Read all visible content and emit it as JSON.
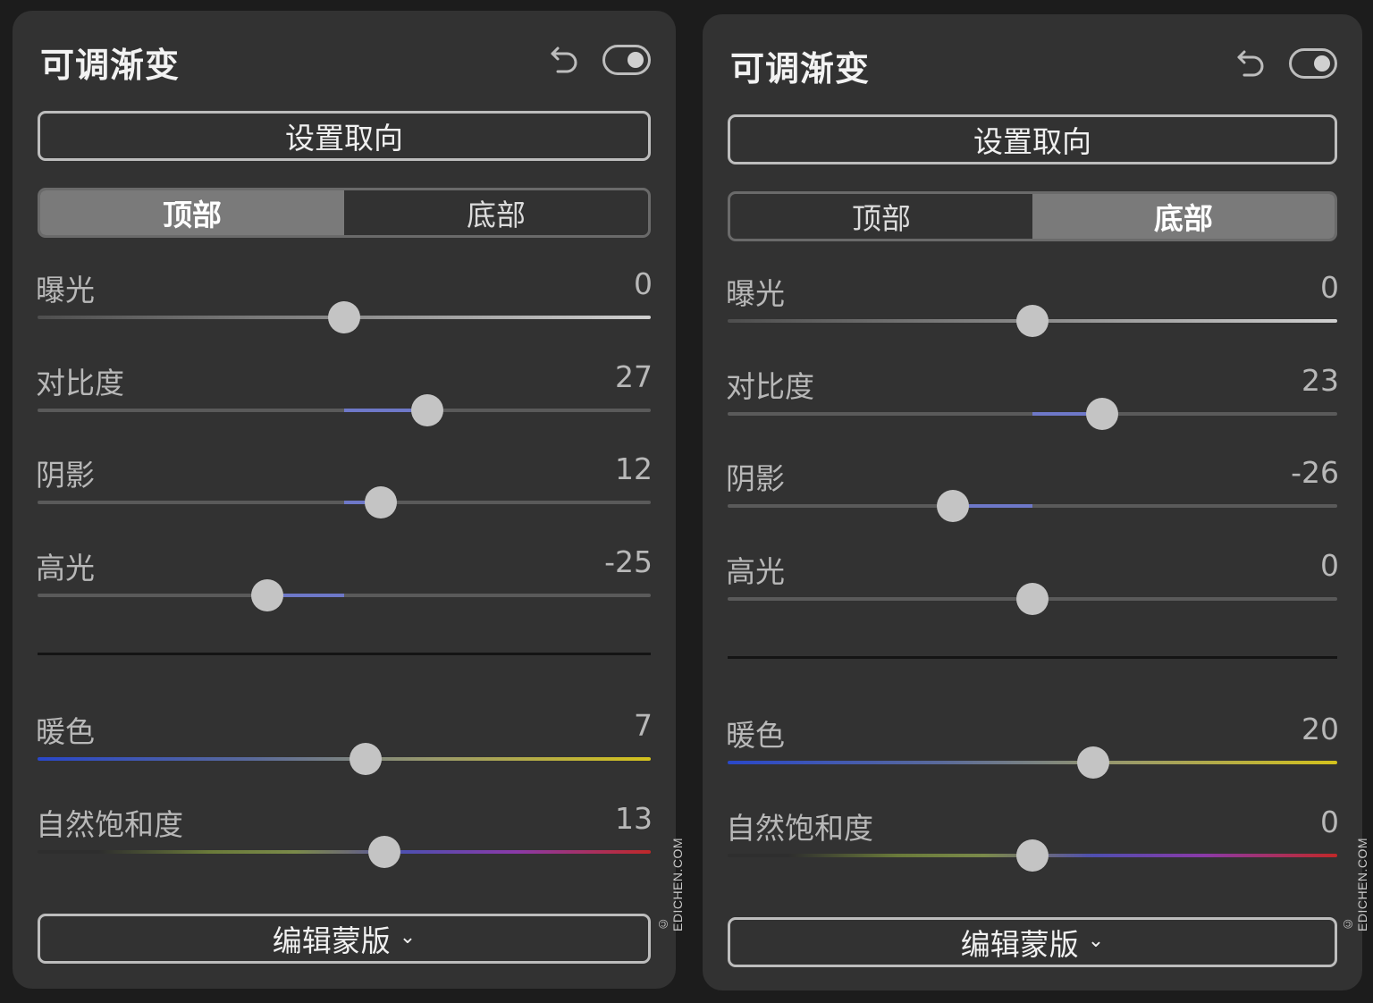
{
  "panels": [
    {
      "title": "可调渐变",
      "orient_button": "设置取向",
      "tabs": [
        "顶部",
        "底部"
      ],
      "active_tab": 0,
      "sliders": [
        {
          "label": "曝光",
          "value": "0",
          "v": 0
        },
        {
          "label": "对比度",
          "value": "27",
          "v": 27
        },
        {
          "label": "阴影",
          "value": "12",
          "v": 12
        },
        {
          "label": "高光",
          "value": "-25",
          "v": -25
        }
      ],
      "color_sliders": [
        {
          "label": "暖色",
          "value": "7",
          "v": 7
        },
        {
          "label": "自然饱和度",
          "value": "13",
          "v": 13
        }
      ],
      "mask_button": "编辑蒙版",
      "watermark": "© EDICHEN.COM"
    },
    {
      "title": "可调渐变",
      "orient_button": "设置取向",
      "tabs": [
        "顶部",
        "底部"
      ],
      "active_tab": 1,
      "sliders": [
        {
          "label": "曝光",
          "value": "0",
          "v": 0
        },
        {
          "label": "对比度",
          "value": "23",
          "v": 23
        },
        {
          "label": "阴影",
          "value": "-26",
          "v": -26
        },
        {
          "label": "高光",
          "value": "0",
          "v": 0
        }
      ],
      "color_sliders": [
        {
          "label": "暖色",
          "value": "20",
          "v": 20
        },
        {
          "label": "自然饱和度",
          "value": "0",
          "v": 0
        }
      ],
      "mask_button": "编辑蒙版",
      "watermark": "© EDICHEN.COM"
    }
  ],
  "slider_range": [
    -100,
    100
  ],
  "colors": {
    "accent_fill": "#6e78c8",
    "panel_bg": "#323232",
    "app_bg": "#1c1c1c"
  }
}
